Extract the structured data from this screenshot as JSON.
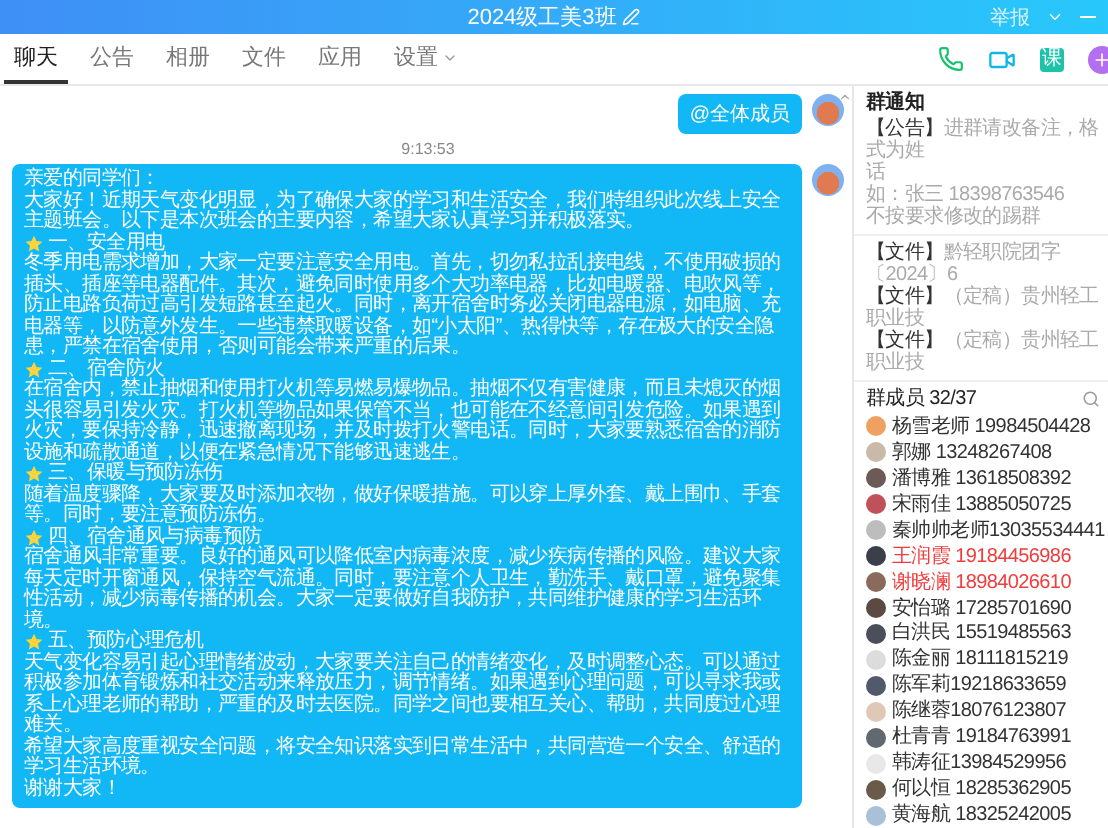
{
  "window": {
    "title": "2024级工美3班",
    "report": "举报"
  },
  "tabs": [
    {
      "label": "聊天",
      "selected": true
    },
    {
      "label": "公告",
      "selected": false
    },
    {
      "label": "相册",
      "selected": false
    },
    {
      "label": "文件",
      "selected": false
    },
    {
      "label": "应用",
      "selected": false
    },
    {
      "label": "设置",
      "selected": false,
      "dropdown": true
    }
  ],
  "toolbar": {
    "course_label": "课"
  },
  "chat": {
    "messages": [
      {
        "kind": "mention",
        "text": "@全体成员"
      },
      {
        "kind": "time",
        "text": "9:13:53"
      },
      {
        "kind": "post",
        "blocks": [
          {
            "kind": "paragraph",
            "text": "亲爱的同学们："
          },
          {
            "kind": "paragraph",
            "text": "大家好！近期天气变化明显，为了确保大家的学习和生活安全，我们特组织此次线上安全主题班会。以下是本次班会的主要内容，希望大家认真学习并积极落实。"
          },
          {
            "kind": "heading",
            "text": "一、安全用电"
          },
          {
            "kind": "paragraph",
            "text": "冬季用电需求增加，大家一定要注意安全用电。首先，切勿私拉乱接电线，不使用破损的插头、插座等电器配件。其次，避免同时使用多个大功率电器，比如电暖器、电吹风等，防止电路负荷过高引发短路甚至起火。同时，离开宿舍时务必关闭电器电源，如电脑、充电器等，以防意外发生。一些违禁取暖设备，如“小太阳”、热得快等，存在极大的安全隐患，严禁在宿舍使用，否则可能会带来严重的后果。"
          },
          {
            "kind": "heading",
            "text": "二、宿舍防火"
          },
          {
            "kind": "paragraph",
            "text": "在宿舍内，禁止抽烟和使用打火机等易燃易爆物品。抽烟不仅有害健康，而且未熄灭的烟头很容易引发火灾。打火机等物品如果保管不当，也可能在不经意间引发危险。如果遇到火灾，要保持冷静，迅速撤离现场，并及时拨打火警电话。同时，大家要熟悉宿舍的消防设施和疏散通道，以便在紧急情况下能够迅速逃生。"
          },
          {
            "kind": "heading",
            "text": "三、保暖与预防冻伤"
          },
          {
            "kind": "paragraph",
            "text": "随着温度骤降，大家要及时添加衣物，做好保暖措施。可以穿上厚外套、戴上围巾、手套等。同时，要注意预防冻伤。"
          },
          {
            "kind": "heading",
            "text": "四、宿舍通风与病毒预防"
          },
          {
            "kind": "paragraph",
            "text": "宿舍通风非常重要。良好的通风可以降低室内病毒浓度，减少疾病传播的风险。建议大家每天定时开窗通风，保持空气流通。同时，要注意个人卫生，勤洗手、戴口罩，避免聚集性活动，减少病毒传播的机会。大家一定要做好自我防护，共同维护健康的学习生活环境。"
          },
          {
            "kind": "heading",
            "text": "五、预防心理危机"
          },
          {
            "kind": "paragraph",
            "text": "天气变化容易引起心理情绪波动，大家要关注自己的情绪变化，及时调整心态。可以通过积极参加体育锻炼和社交活动来释放压力，调节情绪。如果遇到心理问题，可以寻求我或系上心理老师的帮助，严重的及时去医院。同学之间也要相互关心、帮助，共同度过心理难关。"
          },
          {
            "kind": "paragraph",
            "text": "希望大家高度重视安全问题，将安全知识落实到日常生活中，共同营造一个安全、舒适的学习生活环境。"
          },
          {
            "kind": "paragraph",
            "text": "谢谢大家！"
          }
        ]
      }
    ]
  },
  "notices": {
    "title": "群通知",
    "announcement": {
      "tag": "【公告】",
      "lines": [
        "进群请改备注，格式为姓",
        "话",
        "如：张三 18398763546",
        "不按要求修改的踢群"
      ]
    },
    "files": [
      {
        "tag": "【文件】",
        "name": "黔轻职院团字〔2024〕6"
      },
      {
        "tag": "【文件】",
        "name": "（定稿）贵州轻工职业技"
      },
      {
        "tag": "【文件】",
        "name": "（定稿）贵州轻工职业技"
      }
    ]
  },
  "members": {
    "title": "群成员 32/37",
    "list": [
      {
        "name": "杨雪老师 19984504428",
        "highlighted": false,
        "color": "#f0a060"
      },
      {
        "name": "郭娜 13248267408",
        "highlighted": false,
        "color": "#c9b9a8"
      },
      {
        "name": "潘博雅 13618508392",
        "highlighted": false,
        "color": "#6b5a55"
      },
      {
        "name": "宋雨佳 13885050725",
        "highlighted": false,
        "color": "#c0505a"
      },
      {
        "name": "秦帅帅老师13035534441",
        "highlighted": false,
        "color": "#bdbdbd"
      },
      {
        "name": "王润霞 19184456986",
        "highlighted": true,
        "color": "#3a3f4a"
      },
      {
        "name": "谢晓澜 18984026610",
        "highlighted": true,
        "color": "#8a6a5a"
      },
      {
        "name": "安怡璐 17285701690",
        "highlighted": false,
        "color": "#5a4a40"
      },
      {
        "name": "白洪民 15519485563",
        "highlighted": false,
        "color": "#4a4f5a"
      },
      {
        "name": "陈金丽 18111815219",
        "highlighted": false,
        "color": "#dcdcdc"
      },
      {
        "name": "陈军莉19218633659",
        "highlighted": false,
        "color": "#505a6a"
      },
      {
        "name": "陈继蓉18076123807",
        "highlighted": false,
        "color": "#e0c8b8"
      },
      {
        "name": "杜青青 19184763991",
        "highlighted": false,
        "color": "#606870"
      },
      {
        "name": "韩涛征13984529956",
        "highlighted": false,
        "color": "#e8e8e8"
      },
      {
        "name": "何以恒 18285362905",
        "highlighted": false,
        "color": "#6a5a4a"
      },
      {
        "name": "黄海航 18325242005",
        "highlighted": false,
        "color": "#a8c0d8"
      }
    ]
  }
}
